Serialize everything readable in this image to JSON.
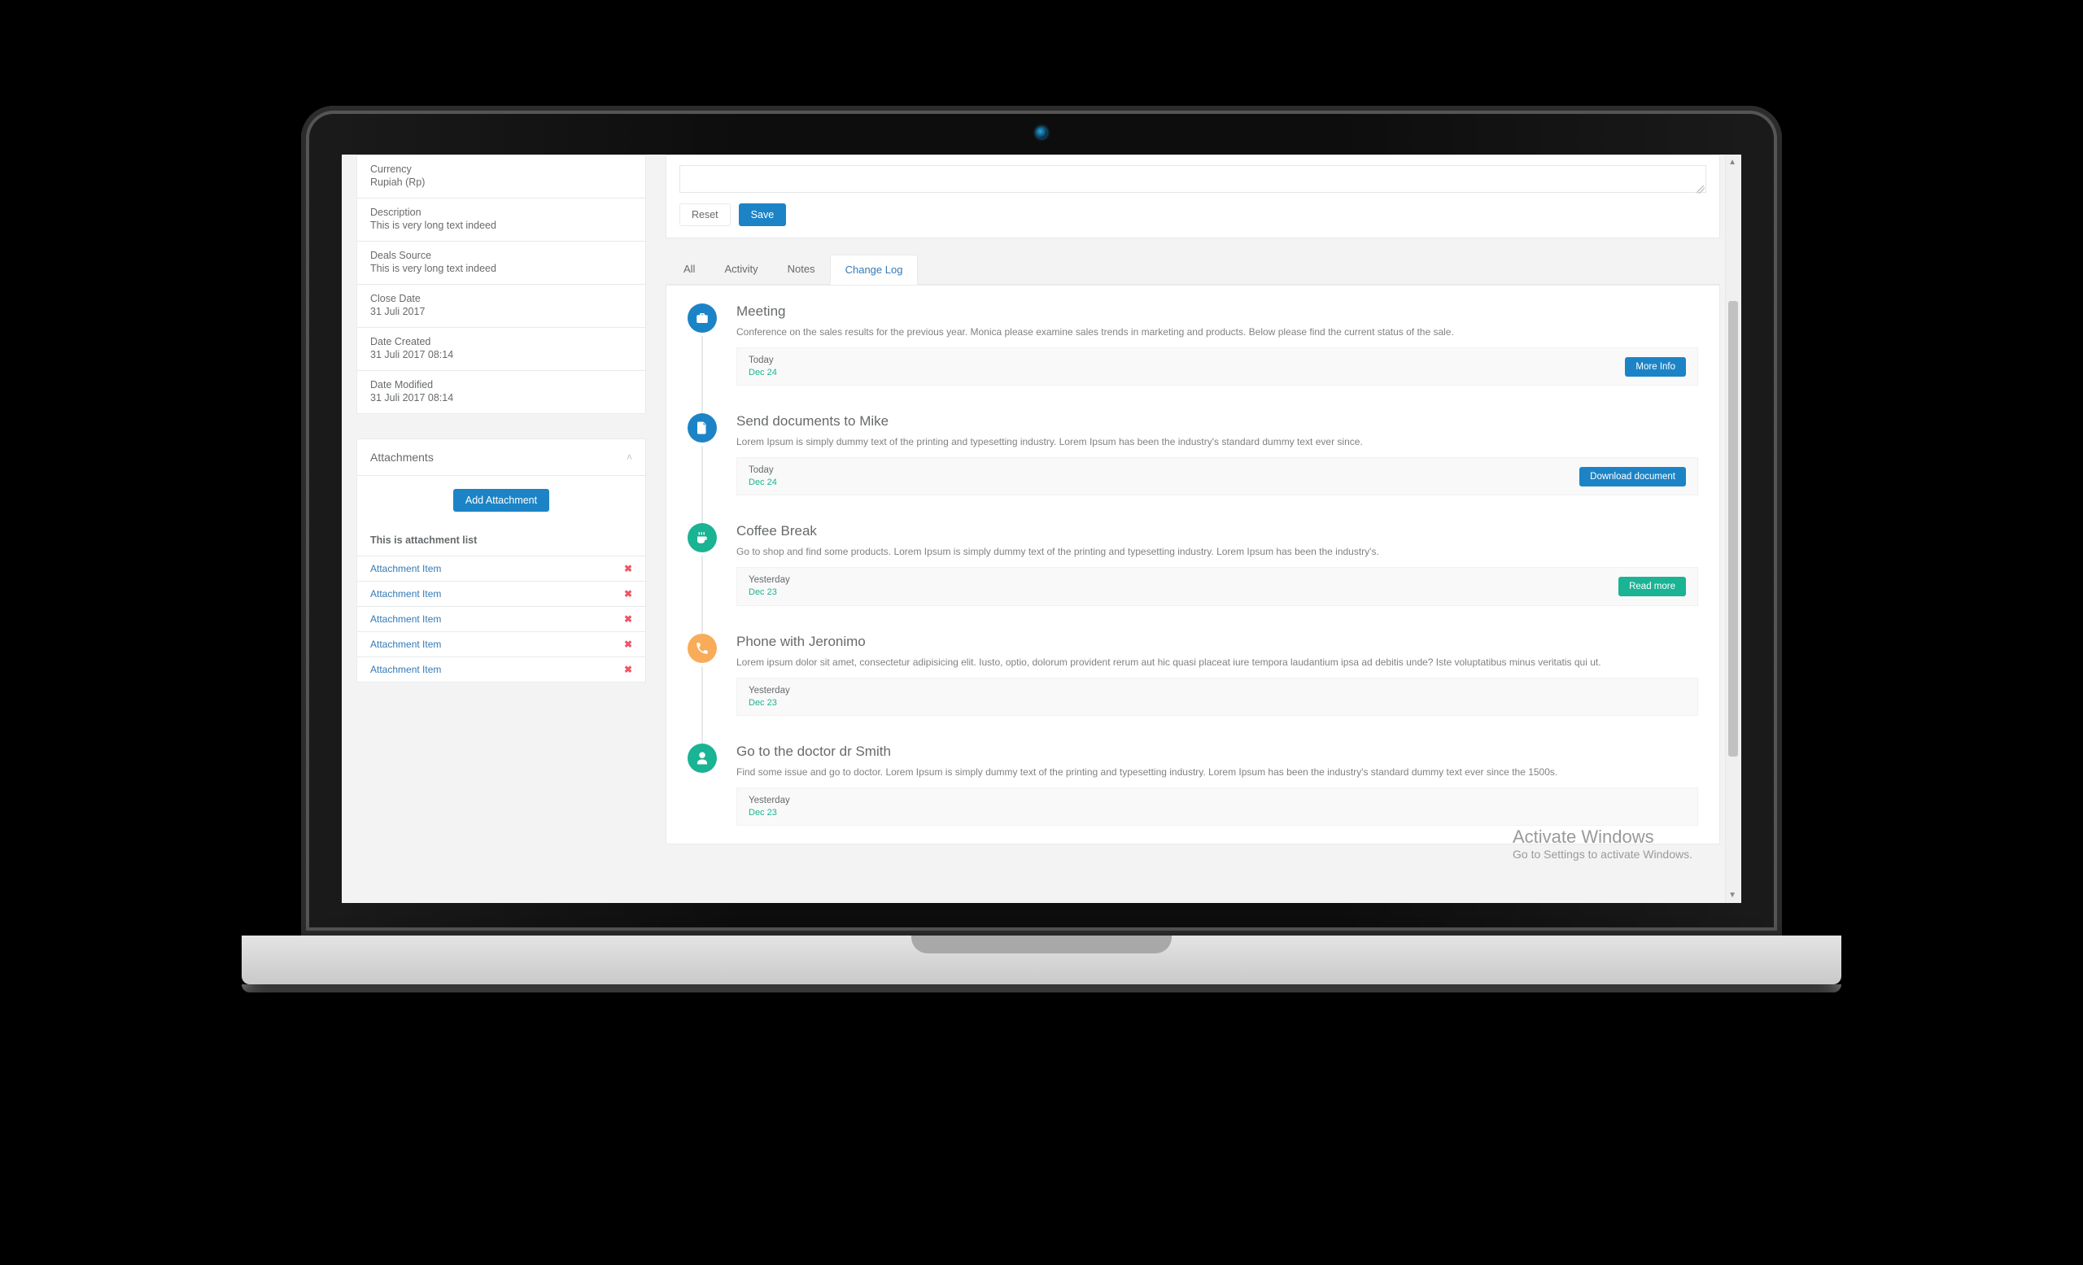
{
  "sidebar": {
    "info": [
      {
        "label": "Currency",
        "value": "Rupiah (Rp)"
      },
      {
        "label": "Description",
        "value": "This is very long text indeed"
      },
      {
        "label": "Deals Source",
        "value": "This is very long text indeed"
      },
      {
        "label": "Close Date",
        "value": "31 Juli 2017"
      },
      {
        "label": "Date Created",
        "value": "31 Juli 2017 08:14"
      },
      {
        "label": "Date Modified",
        "value": "31 Juli 2017 08:14"
      }
    ],
    "attachments": {
      "heading": "Attachments",
      "add_label": "Add Attachment",
      "list_title": "This is attachment list",
      "items": [
        {
          "name": "Attachment Item"
        },
        {
          "name": "Attachment Item"
        },
        {
          "name": "Attachment Item"
        },
        {
          "name": "Attachment Item"
        },
        {
          "name": "Attachment Item"
        }
      ],
      "delete_glyph": "✖"
    }
  },
  "compose": {
    "reset_label": "Reset",
    "save_label": "Save"
  },
  "tabs": {
    "items": [
      "All",
      "Activity",
      "Notes",
      "Change Log"
    ],
    "active_index": 3
  },
  "timeline": [
    {
      "icon": "briefcase",
      "color": "ic-blue",
      "title": "Meeting",
      "desc": "Conference on the sales results for the previous year. Monica please examine sales trends in marketing and products. Below please find the current status of the sale.",
      "when": "Today",
      "date": "Dec 24",
      "action_label": "More Info",
      "action_style": "btn-primary"
    },
    {
      "icon": "file",
      "color": "ic-blue",
      "title": "Send documents to Mike",
      "desc": "Lorem Ipsum is simply dummy text of the printing and typesetting industry. Lorem Ipsum has been the industry's standard dummy text ever since.",
      "when": "Today",
      "date": "Dec 24",
      "action_label": "Download document",
      "action_style": "btn-primary"
    },
    {
      "icon": "coffee",
      "color": "ic-teal",
      "title": "Coffee Break",
      "desc": "Go to shop and find some products. Lorem Ipsum is simply dummy text of the printing and typesetting industry. Lorem Ipsum has been the industry's.",
      "when": "Yesterday",
      "date": "Dec 23",
      "action_label": "Read more",
      "action_style": "btn-teal"
    },
    {
      "icon": "phone",
      "color": "ic-orange",
      "title": "Phone with Jeronimo",
      "desc": "Lorem ipsum dolor sit amet, consectetur adipisicing elit. Iusto, optio, dolorum provident rerum aut hic quasi placeat iure tempora laudantium ipsa ad debitis unde? Iste voluptatibus minus veritatis qui ut.",
      "when": "Yesterday",
      "date": "Dec 23",
      "action_label": "",
      "action_style": ""
    },
    {
      "icon": "user-md",
      "color": "ic-teal",
      "title": "Go to the doctor dr Smith",
      "desc": "Find some issue and go to doctor. Lorem Ipsum is simply dummy text of the printing and typesetting industry. Lorem Ipsum has been the industry's standard dummy text ever since the 1500s.",
      "when": "Yesterday",
      "date": "Dec 23",
      "action_label": "",
      "action_style": ""
    }
  ],
  "watermark": {
    "line1": "Activate Windows",
    "line2": "Go to Settings to activate Windows."
  }
}
